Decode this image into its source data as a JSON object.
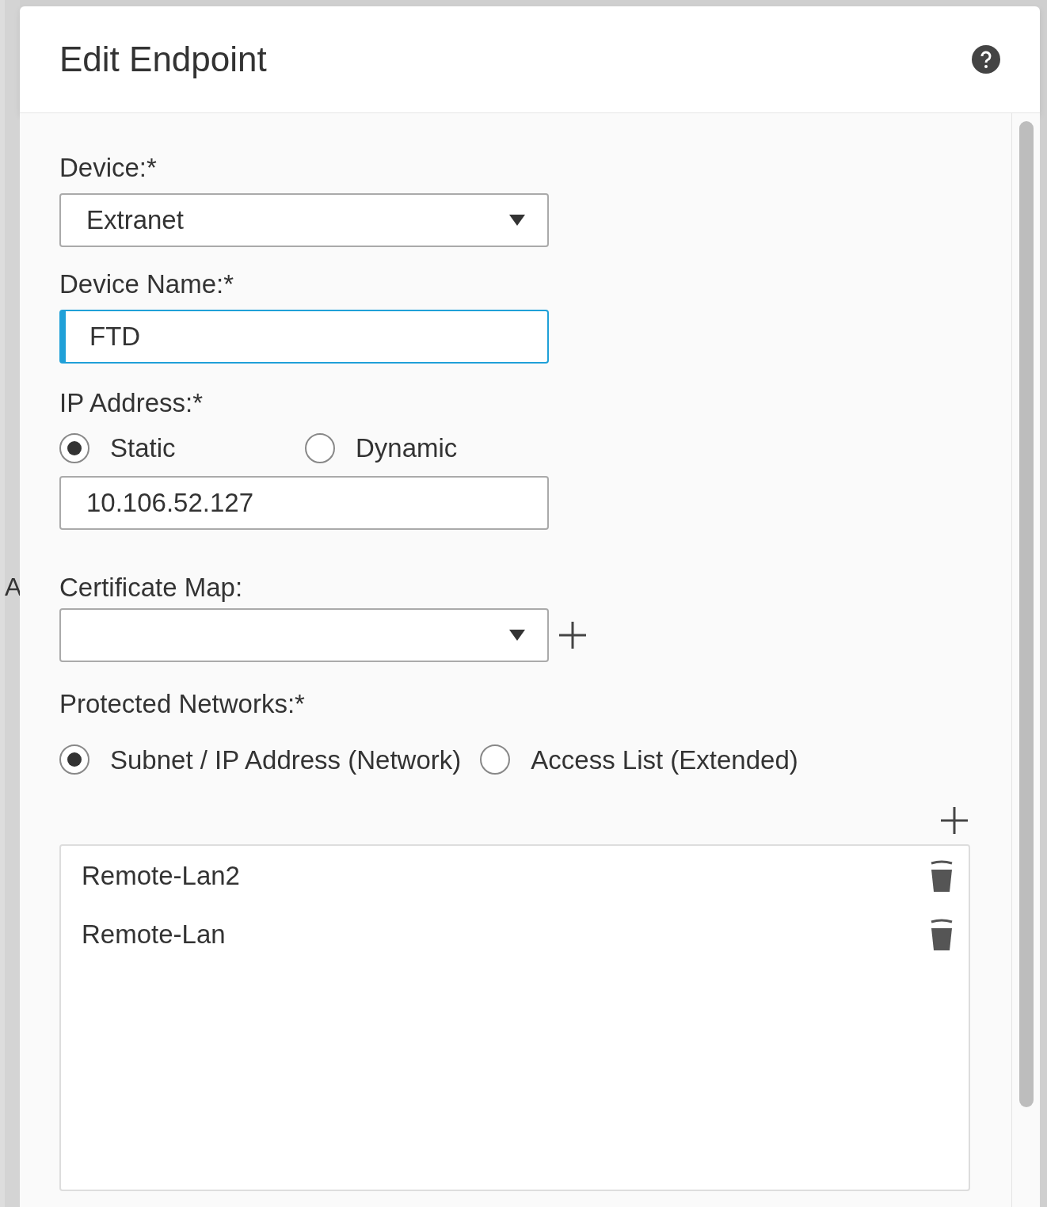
{
  "background": {
    "fragment": "A"
  },
  "dialog": {
    "title": "Edit Endpoint"
  },
  "device": {
    "label": "Device:*",
    "value": "Extranet"
  },
  "device_name": {
    "label": "Device Name:*",
    "value": "FTD",
    "focused": true
  },
  "ip_address": {
    "label": "IP Address:*",
    "options": [
      {
        "label": "Static",
        "selected": true
      },
      {
        "label": "Dynamic",
        "selected": false
      }
    ],
    "value": "10.106.52.127"
  },
  "certificate_map": {
    "label": "Certificate Map:"
  },
  "protected_networks": {
    "label": "Protected Networks:*",
    "options": [
      {
        "label": "Subnet / IP Address (Network)",
        "selected": true
      },
      {
        "label": "Access List (Extended)",
        "selected": false
      }
    ],
    "items": [
      {
        "name": "Remote-Lan2"
      },
      {
        "name": "Remote-Lan"
      }
    ]
  }
}
